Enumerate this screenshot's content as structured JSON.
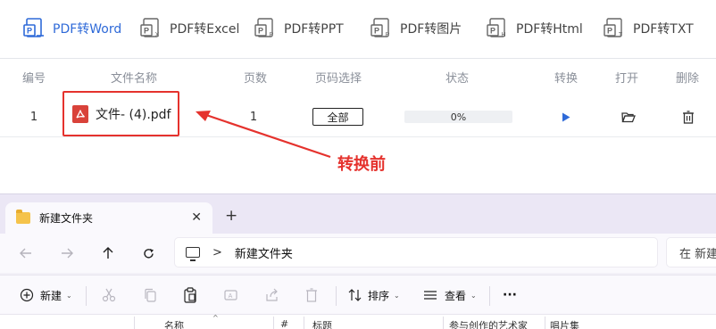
{
  "tabs": [
    {
      "label": "PDF转Word",
      "icon": "pdf-to-word-icon",
      "icon_letter": "W",
      "active": true
    },
    {
      "label": "PDF转Excel",
      "icon": "pdf-to-excel-icon",
      "icon_letter": "X",
      "active": false
    },
    {
      "label": "PDF转PPT",
      "icon": "pdf-to-ppt-icon",
      "icon_letter": "P",
      "active": false
    },
    {
      "label": "PDF转图片",
      "icon": "pdf-to-image-icon",
      "icon_letter": "P",
      "active": false
    },
    {
      "label": "PDF转Html",
      "icon": "pdf-to-html-icon",
      "icon_letter": "H",
      "active": false
    },
    {
      "label": "PDF转TXT",
      "icon": "pdf-to-txt-icon",
      "icon_letter": "T",
      "active": false
    }
  ],
  "table": {
    "headers": {
      "index": "编号",
      "filename": "文件名称",
      "pages": "页数",
      "page_select": "页码选择",
      "status": "状态",
      "convert": "转换",
      "open": "打开",
      "delete": "删除"
    },
    "rows": [
      {
        "index": "1",
        "filename": "文件- (4).pdf",
        "pages": "1",
        "page_select": "全部",
        "progress_text": "0%",
        "progress": 0
      }
    ]
  },
  "annotation": {
    "text": "转换前",
    "color": "#e5322d"
  },
  "explorer": {
    "tab_title": "新建文件夹",
    "tab_close": "✕",
    "new_tab": "+",
    "address": "新建文件夹",
    "address_sep": ">",
    "search_placeholder": "在 新建",
    "toolbar": {
      "new_label": "新建",
      "sort_label": "排序",
      "view_label": "查看",
      "more_label": "···"
    },
    "columns": [
      "名称",
      "#",
      "标题",
      "参与创作的艺术家",
      "唱片集"
    ]
  },
  "colors": {
    "accent": "#2f6ad8",
    "highlight": "#e5322d",
    "pdf_red": "#d9423a"
  }
}
